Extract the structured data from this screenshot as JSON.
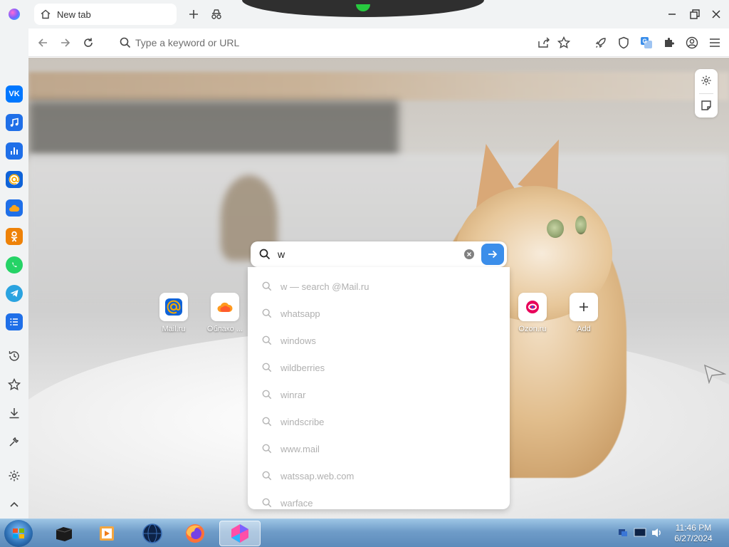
{
  "tab": {
    "title": "New tab"
  },
  "omnibox": {
    "placeholder": "Type a keyword or URL"
  },
  "speed_dial": [
    {
      "label": "Mail.ru"
    },
    {
      "label": "Облако ..."
    },
    {
      "label": "Ozon.ru"
    },
    {
      "label": "Add"
    }
  ],
  "search": {
    "value": "w",
    "suggestions": [
      "w — search @Mail.ru",
      "whatsapp",
      "windows",
      "wildberries",
      "winrar",
      "windscribe",
      "www.mail",
      "watssap.web.com",
      "warface"
    ]
  },
  "clock": {
    "time": "11:46 PM",
    "date": "6/27/2024"
  },
  "colors": {
    "accent": "#3b8eea",
    "vk": "#0077ff",
    "ok": "#ee8208",
    "whatsapp": "#25d366",
    "telegram": "#2aa3e0"
  }
}
